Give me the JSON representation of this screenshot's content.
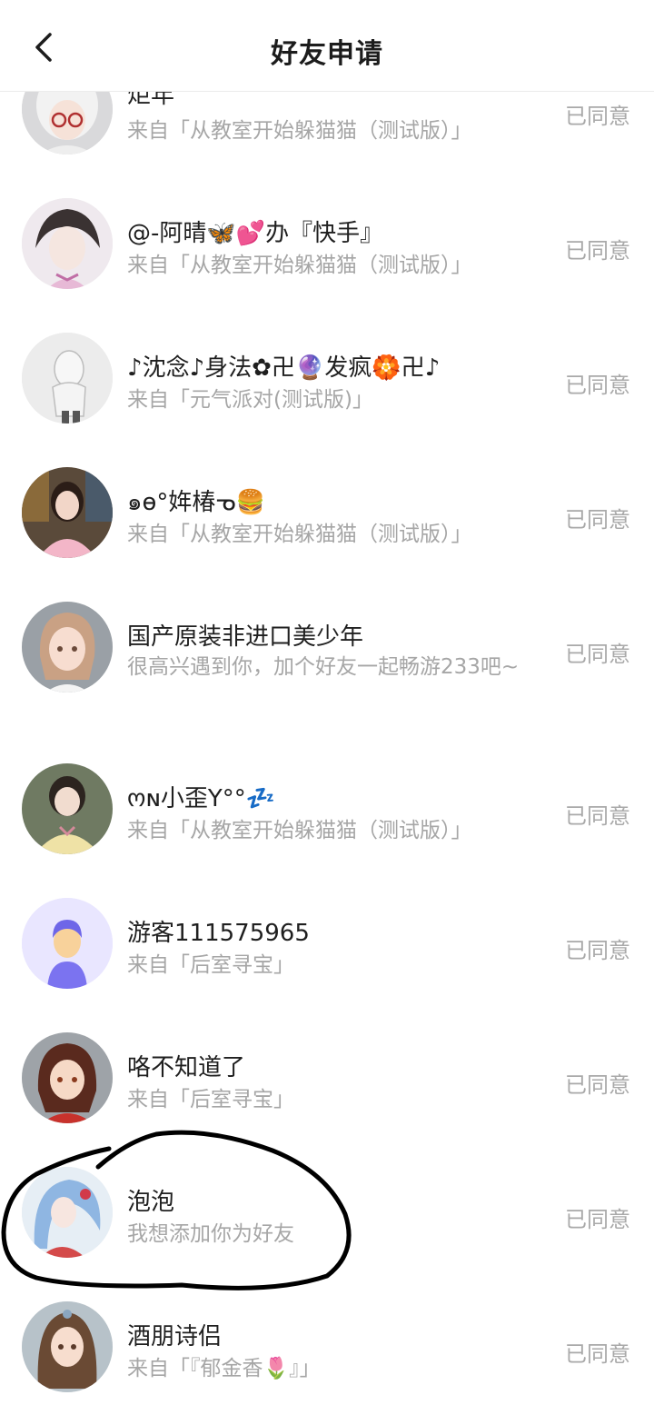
{
  "header": {
    "title": "好友申请",
    "back_icon": "chevron-left-icon"
  },
  "requests": [
    {
      "name": "炬年",
      "subtitle": "来自「从教室开始躲猫猫（测试版）」",
      "status": "已同意",
      "avatar": "anime-girl-white-hair-glasses"
    },
    {
      "name": "@-阿晴🦋💕办『快手』",
      "subtitle": "来自「从教室开始躲猫猫（测试版）」",
      "status": "已同意",
      "avatar": "anime-boy-sketch"
    },
    {
      "name": "♪沈念♪身法✿卍🔮发疯🏵️卍♪",
      "subtitle": "来自「元气派对(测试版)」",
      "status": "已同意",
      "avatar": "sketch-figure-gray"
    },
    {
      "name": "๑ɵ°姩椿ᓀ🍔",
      "subtitle": "来自「从教室开始躲猫猫（测试版）」",
      "status": "已同意",
      "avatar": "photo-girl-pink-sweater"
    },
    {
      "name": "国产原装非进口美少年",
      "subtitle": "很高兴遇到你，加个好友一起畅游233吧~",
      "status": "已同意",
      "avatar": "3d-character-brown-hair"
    },
    {
      "name": "ოɴ小歪Y°°💤",
      "subtitle": "来自「从教室开始躲猫猫（测试版）」",
      "status": "已同意",
      "avatar": "photo-girl-yellow-jacket"
    },
    {
      "name": "游客111575965",
      "subtitle": "来自「后室寻宝」",
      "status": "已同意",
      "avatar": "default-user-icon"
    },
    {
      "name": "咯不知道了",
      "subtitle": "来自「后室寻宝」",
      "status": "已同意",
      "avatar": "3d-character-red-outfit"
    },
    {
      "name": "泡泡",
      "subtitle": "我想添加你为好友",
      "status": "已同意",
      "avatar": "anime-girl-blue-hair"
    },
    {
      "name": "酒朋诗侣",
      "subtitle": "来自「『郁金香🌷』」",
      "status": "已同意",
      "avatar": "3d-character-long-hair"
    }
  ],
  "colors": {
    "title": "#1c1c1c",
    "name": "#1f1f1f",
    "subtitle": "#a6a6a6",
    "status": "#a9a9a9",
    "scribble": "#000000"
  }
}
